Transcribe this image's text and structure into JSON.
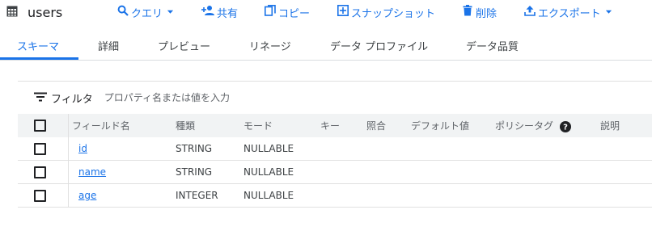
{
  "header": {
    "title": "users",
    "buttons": {
      "query": "クエリ",
      "share": "共有",
      "copy": "コピー",
      "snapshot": "スナップショット",
      "delete": "削除",
      "export": "エクスポート"
    }
  },
  "tabs": [
    "スキーマ",
    "詳細",
    "プレビュー",
    "リネージ",
    "データ プロファイル",
    "データ品質"
  ],
  "active_tab": "スキーマ",
  "filter": {
    "label": "フィルタ",
    "placeholder": "プロパティ名または値を入力"
  },
  "table": {
    "headers": {
      "name": "フィールド名",
      "type": "種類",
      "mode": "モード",
      "key": "キー",
      "collation": "照合",
      "default": "デフォルト値",
      "policy_tags": "ポリシータグ",
      "description": "説明"
    },
    "rows": [
      {
        "name": "id",
        "type": "STRING",
        "mode": "NULLABLE"
      },
      {
        "name": "name",
        "type": "STRING",
        "mode": "NULLABLE"
      },
      {
        "name": "age",
        "type": "INTEGER",
        "mode": "NULLABLE"
      }
    ]
  },
  "colors": {
    "accent": "#1a73e8",
    "text": "#202124",
    "header_bg": "#f1f3f4",
    "border": "#e0e0e0"
  },
  "icons": [
    "table-icon",
    "search-icon",
    "chevron-down-icon",
    "person-add-icon",
    "copy-icon",
    "snapshot-icon",
    "delete-icon",
    "upload-icon",
    "filter-icon",
    "help-icon"
  ]
}
